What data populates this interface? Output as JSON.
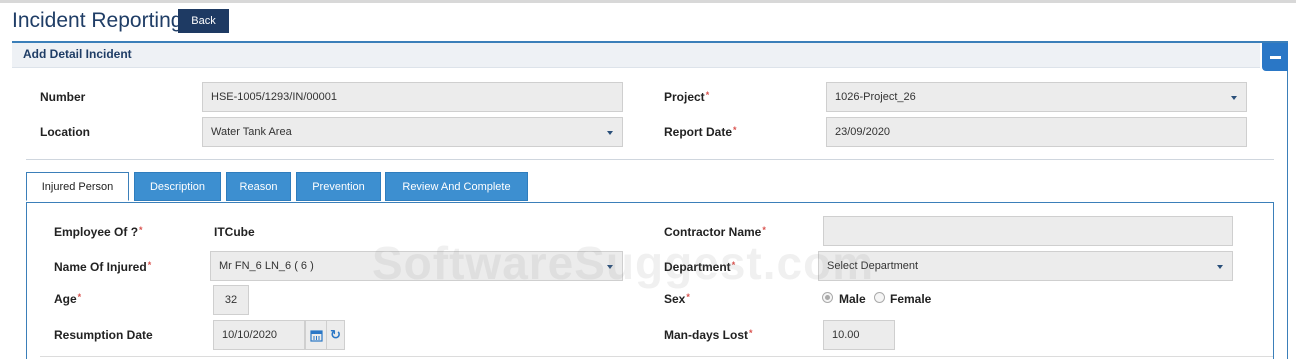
{
  "page": {
    "title": "Incident Reporting",
    "back_label": "Back"
  },
  "panel": {
    "title": "Add Detail Incident"
  },
  "header_form": {
    "number": {
      "label": "Number",
      "value": "HSE-1005/1293/IN/00001"
    },
    "location": {
      "label": "Location",
      "value": "Water Tank Area"
    },
    "project": {
      "label": "Project",
      "required_mark": "*",
      "value": "1026-Project_26"
    },
    "report_date": {
      "label": "Report Date",
      "required_mark": "*",
      "value": "23/09/2020"
    }
  },
  "tabs": [
    {
      "label": "Injured Person",
      "active": true
    },
    {
      "label": "Description",
      "active": false
    },
    {
      "label": "Reason",
      "active": false
    },
    {
      "label": "Prevention",
      "active": false
    },
    {
      "label": "Review And Complete",
      "active": false
    }
  ],
  "injured_form": {
    "employee_of": {
      "label": "Employee Of ?",
      "required_mark": "*",
      "value": "ITCube"
    },
    "contractor_name": {
      "label": "Contractor Name",
      "required_mark": "*",
      "value": ""
    },
    "name_of_injured": {
      "label": "Name Of Injured",
      "required_mark": "*",
      "value": "Mr FN_6 LN_6 ( 6 )"
    },
    "department": {
      "label": "Department",
      "required_mark": "*",
      "value": "Select Department"
    },
    "age": {
      "label": "Age",
      "required_mark": "*",
      "value": "32"
    },
    "sex": {
      "label": "Sex",
      "required_mark": "*",
      "options": [
        "Male",
        "Female"
      ],
      "selected": "Male"
    },
    "resumption_date": {
      "label": "Resumption Date",
      "value": "10/10/2020"
    },
    "man_days_lost": {
      "label": "Man-days Lost",
      "required_mark": "*",
      "value": "10.00"
    }
  },
  "watermark": "SoftwareSuggest.com",
  "colors": {
    "accent": "#2a77c6",
    "title": "#1f3d66",
    "tab_inactive": "#3d8fd0",
    "required": "#d9534f"
  },
  "icons": [
    "minus-icon",
    "chevron-down-icon",
    "calendar-icon",
    "refresh-icon"
  ]
}
